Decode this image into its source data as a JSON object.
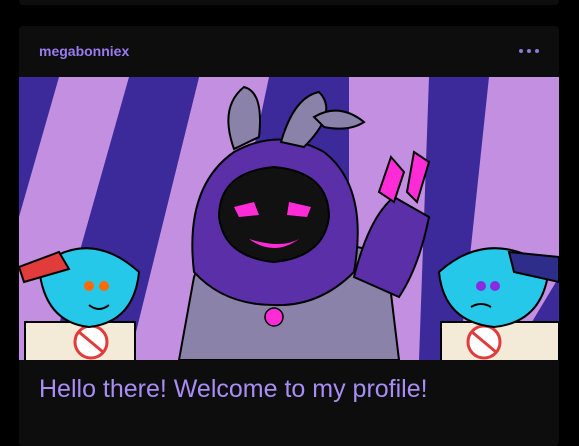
{
  "post": {
    "username": "megabonniex",
    "more_label": "•••",
    "text": "Hello there! Welcome to my profile!"
  },
  "colors": {
    "background": "#000000",
    "card": "#0d0d0d",
    "accent": "#9a7bf0",
    "text": "#a98df5"
  },
  "image": {
    "description_icon": "character-drawing"
  }
}
